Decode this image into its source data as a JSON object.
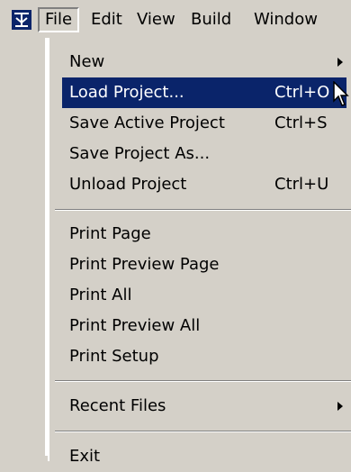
{
  "menubar": {
    "items": [
      {
        "label": "File"
      },
      {
        "label": "Edit"
      },
      {
        "label": "View"
      },
      {
        "label": "Build"
      },
      {
        "label": "Window"
      }
    ]
  },
  "file_menu": {
    "items": [
      {
        "label": "New",
        "shortcut": "",
        "submenu": true
      },
      {
        "label": "Load Project...",
        "shortcut": "Ctrl+O",
        "highlighted": true
      },
      {
        "label": "Save Active Project",
        "shortcut": "Ctrl+S"
      },
      {
        "label": "Save Project As...",
        "shortcut": ""
      },
      {
        "label": "Unload Project",
        "shortcut": "Ctrl+U"
      },
      {
        "label": "Print Page",
        "shortcut": ""
      },
      {
        "label": "Print Preview Page",
        "shortcut": ""
      },
      {
        "label": "Print All",
        "shortcut": ""
      },
      {
        "label": "Print Preview All",
        "shortcut": ""
      },
      {
        "label": "Print Setup",
        "shortcut": ""
      },
      {
        "label": "Recent Files",
        "shortcut": "",
        "submenu": true
      },
      {
        "label": "Exit",
        "shortcut": ""
      }
    ]
  },
  "colors": {
    "menu_bg": "#d4d0c8",
    "highlight_bg": "#0a246a",
    "highlight_text": "#ffffff"
  },
  "icons": {
    "app": "app-logo-icon",
    "submenu": "submenu-arrow-icon",
    "cursor": "mouse-pointer-icon"
  }
}
